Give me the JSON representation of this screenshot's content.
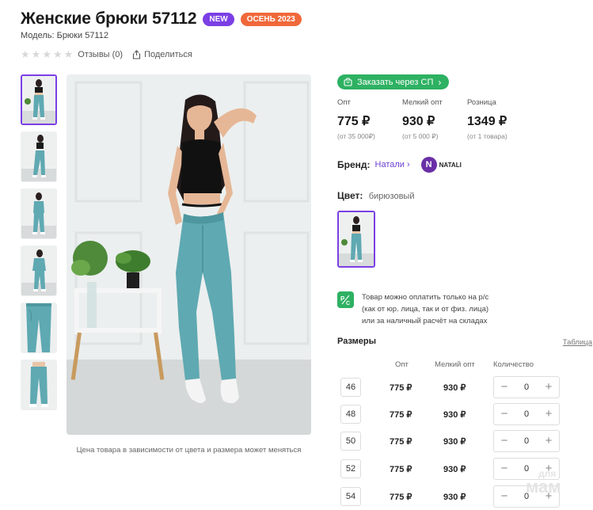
{
  "product": {
    "title": "Женские брюки 57112",
    "badges": [
      {
        "label": "NEW",
        "color": "#7b3fe4"
      },
      {
        "label": "ОСЕНЬ 2023",
        "color": "#f0683a"
      }
    ],
    "model": "Модель: Брюки 57112",
    "rating_stars": 0,
    "reviews": "Отзывы (0)",
    "share": "Поделиться"
  },
  "gallery": {
    "caption": "Цена товара в зависимости от цвета и размера может меняться",
    "thumb_count": 6,
    "active_thumb": 0
  },
  "order_button": "Заказать через СП",
  "prices": [
    {
      "label": "Опт",
      "value": "775 ₽",
      "sub": "(от 35 000₽)"
    },
    {
      "label": "Мелкий опт",
      "value": "930 ₽",
      "sub": "(от 5 000 ₽)"
    },
    {
      "label": "Розница",
      "value": "1349 ₽",
      "sub": "(от 1 товара)"
    }
  ],
  "brand": {
    "label": "Бренд:",
    "name": "Натали",
    "logo_letter": "N",
    "logo_text": "NATALI"
  },
  "color": {
    "label": "Цвет:",
    "value": "бирюзовый"
  },
  "payment": {
    "icon": "P/C",
    "lines": [
      "Товар можно оплатить только на р/с",
      "(как от юр. лица, так и от физ. лица)",
      "или за наличный расчёт на складах"
    ]
  },
  "sizes": {
    "title": "Размеры",
    "table_link": "Таблица",
    "headers": {
      "opt": "Опт",
      "small_opt": "Мелкий опт",
      "qty": "Количество"
    },
    "rows": [
      {
        "size": "46",
        "opt": "775 ₽",
        "small_opt": "930 ₽",
        "qty": "0"
      },
      {
        "size": "48",
        "opt": "775 ₽",
        "small_opt": "930 ₽",
        "qty": "0"
      },
      {
        "size": "50",
        "opt": "775 ₽",
        "small_opt": "930 ₽",
        "qty": "0"
      },
      {
        "size": "52",
        "opt": "775 ₽",
        "small_opt": "930 ₽",
        "qty": "0"
      },
      {
        "size": "54",
        "opt": "775 ₽",
        "small_opt": "930 ₽",
        "qty": "0"
      }
    ]
  },
  "watermark": {
    "line1": "для",
    "line2": "мам"
  },
  "colors": {
    "accent": "#7b3fe4",
    "green": "#2eb162",
    "season": "#f0683a",
    "pants": "#5fa9b2"
  }
}
